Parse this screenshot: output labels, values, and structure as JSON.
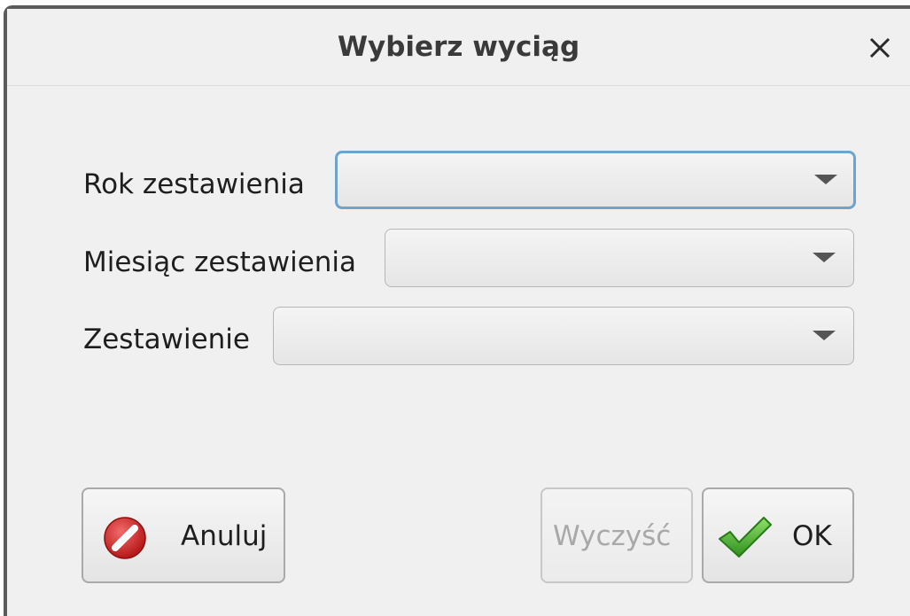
{
  "dialog": {
    "title": "Wybierz wyciąg",
    "close_icon": "close-icon"
  },
  "fields": {
    "year_label": "Rok zestawienia",
    "year_value": "",
    "month_label": "Miesiąc zestawienia",
    "month_value": "",
    "statement_label": "Zestawienie",
    "statement_value": ""
  },
  "buttons": {
    "cancel_label": "Anuluj",
    "cancel_icon": "cancel-icon",
    "clear_label": "Wyczyść",
    "clear_enabled": false,
    "ok_label": "OK",
    "ok_icon": "checkmark-icon"
  },
  "colors": {
    "focus_border": "#6ea4cc",
    "cancel_icon_red": "#d42b2b",
    "ok_icon_green": "#3fa52b",
    "disabled_text": "#a8a8a8"
  }
}
